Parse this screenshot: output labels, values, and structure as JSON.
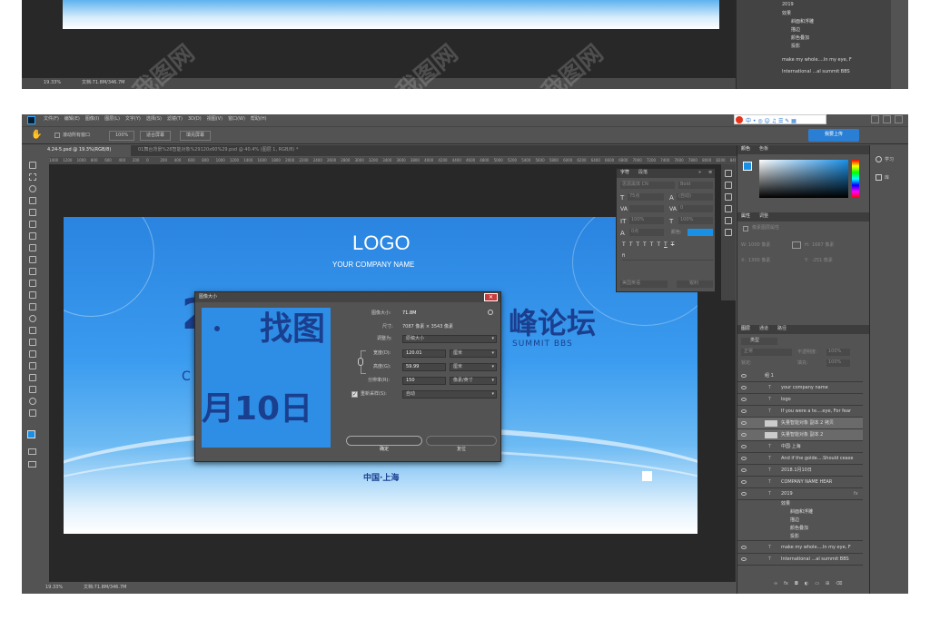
{
  "top": {
    "zoom": "19.33%",
    "doc": "文档:71.8M/346.7M",
    "layers": [
      "2019",
      "效果",
      "斜面和浮雕",
      "描边",
      "颜色叠加",
      "投影",
      "make my whole....In my eye, F",
      "International ...al summit BBS"
    ]
  },
  "menubar": {
    "items": [
      "文件(F)",
      "编辑(E)",
      "图像(I)",
      "图层(L)",
      "文字(Y)",
      "选择(S)",
      "滤镜(T)",
      "3D(D)",
      "视图(V)",
      "窗口(W)",
      "帮助(H)"
    ],
    "upload": "我要上传"
  },
  "options": {
    "scroll_all": "滚动所有窗口",
    "zoom": "100%",
    "fit": "适合屏幕",
    "fill": "填充屏幕"
  },
  "tabs": [
    {
      "label": "4.24-5.psd @ 19.3%(RGB/8)"
    },
    {
      "label": "01舞台背景%28智能对象%29120x60%29.psd @ 40.4% (图层 1, RGB/8) *"
    }
  ],
  "ruler": [
    "1400",
    "1200",
    "1000",
    "800",
    "600",
    "400",
    "200",
    "0",
    "200",
    "400",
    "600",
    "800",
    "1000",
    "1200",
    "1400",
    "1600",
    "1800",
    "2000",
    "2200",
    "2400",
    "2600",
    "2800",
    "3000",
    "3200",
    "3400",
    "3600",
    "3800",
    "4000",
    "4200",
    "4400",
    "4600",
    "4800",
    "5000",
    "5200",
    "5400",
    "5600",
    "5800",
    "6000",
    "6200",
    "6400",
    "6600",
    "6800",
    "7000",
    "7200",
    "7400",
    "7600",
    "7800",
    "8000",
    "8200",
    "8400"
  ],
  "canvas": {
    "logo": "LOGO",
    "company": "YOUR COMPANY NAME",
    "title_right": "峰论坛",
    "summit": "SUMMIT BBS",
    "big_left": "2",
    "c_left": "C",
    "location": "中国·上海"
  },
  "dialog": {
    "title": "图像大小",
    "preview_big": "找图",
    "preview_date": "月10日",
    "size_label": "图像大小:",
    "size_value": "71.8M",
    "dim_label": "尺寸:",
    "dim_value": "7087 像素 × 3543 像素",
    "fit_label": "调整为:",
    "fit_value": "原稿大小",
    "width_label": "宽度(D):",
    "width_value": "120.01",
    "width_unit": "厘米",
    "height_label": "高度(G):",
    "height_value": "59.99",
    "height_unit": "厘米",
    "res_label": "分辨率(R):",
    "res_value": "150",
    "res_unit": "像素/英寸",
    "resample_label": "重新采样(S):",
    "resample_value": "自动",
    "ok": "确定",
    "reset": "复位"
  },
  "char_panel": {
    "tab1": "字符",
    "tab2": "段落",
    "lang": "美国英语",
    "aa": "锐利",
    "font": "思源黑体 CN",
    "weight": "Bold",
    "size": "75点",
    "leading": "(自动)",
    "tracking": "0",
    "scale_v": "100%",
    "scale_h": "100%",
    "baseline": "0点",
    "color_label": "颜色:",
    "tt": "T"
  },
  "right_panel": {
    "color_tab": "颜色",
    "swatch_tab": "色板",
    "learn": "学习",
    "lib": "库",
    "props_tab": "属性",
    "adjust_tab": "调整",
    "no_props": "像素图层属性",
    "w_label": "W:",
    "w_value": "1000 像素",
    "h_label": "H:",
    "h_value": "1667 像素",
    "x_label": "X:",
    "x_value": "1300 像素",
    "y_label": "Y:",
    "y_value": "-251 像素"
  },
  "layers_panel": {
    "tabs": [
      "图层",
      "通道",
      "路径"
    ],
    "kind": "类型",
    "mode": "正常",
    "opacity_label": "不透明度:",
    "opacity": "100%",
    "lock_label": "锁定:",
    "fill_label": "填充:",
    "fill": "100%",
    "rows": [
      "组 1",
      "your company name",
      "logo",
      "If you were a te....eye, For fear",
      "矢量智能对象 副本 2 拷贝",
      "矢量智能对象 副本 2",
      "中国·上海",
      "And if the golde....Should cease",
      "2018.1月10日",
      "COMPANY NAME HEAR",
      "2019",
      "效果",
      "斜面和浮雕",
      "描边",
      "颜色叠加",
      "投影",
      "make my whole....In my eye, F",
      "International ...al summit BBS"
    ]
  },
  "status": {
    "zoom": "19.33%",
    "doc": "文档:71.8M/346.7M"
  },
  "colors": {
    "accent": "#1a8fe6",
    "canvas_blue": "#2e8ee6",
    "title_navy": "#1b3f8f",
    "ps_bg": "#535353"
  }
}
